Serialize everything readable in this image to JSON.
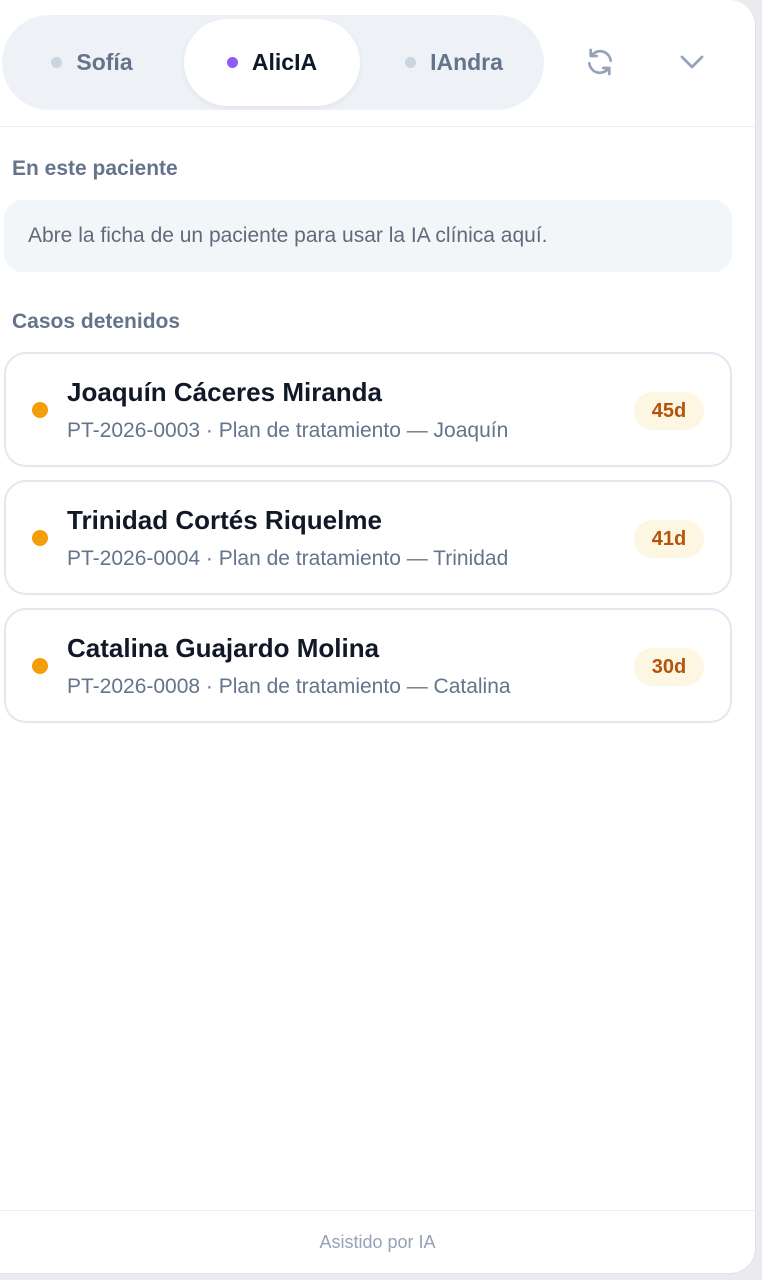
{
  "header": {
    "tabs": [
      {
        "label": "Sofía",
        "active": false
      },
      {
        "label": "AlicIA",
        "active": true
      },
      {
        "label": "IAndra",
        "active": false
      }
    ],
    "refresh_icon": "refresh-icon",
    "collapse_icon": "chevron-down-icon",
    "active_dot_color": "#8b5cf6",
    "inactive_dot_color": "#cbd5e1"
  },
  "patient_section": {
    "title": "En este paciente",
    "notice": "Abre la ficha de un paciente para usar la IA clínica aquí."
  },
  "stalled_section": {
    "title": "Casos detenidos",
    "status_color": "#f59e0b",
    "cases": [
      {
        "name": "Joaquín Cáceres Miranda",
        "meta": "PT-2026-0003 · Plan de tratamiento — Joaquín",
        "days": "45d"
      },
      {
        "name": "Trinidad Cortés Riquelme",
        "meta": "PT-2026-0004 · Plan de tratamiento — Trinidad",
        "days": "41d"
      },
      {
        "name": "Catalina Guajardo Molina",
        "meta": "PT-2026-0008 · Plan de tratamiento — Catalina",
        "days": "30d"
      }
    ]
  },
  "footer": {
    "text": "Asistido por IA"
  }
}
